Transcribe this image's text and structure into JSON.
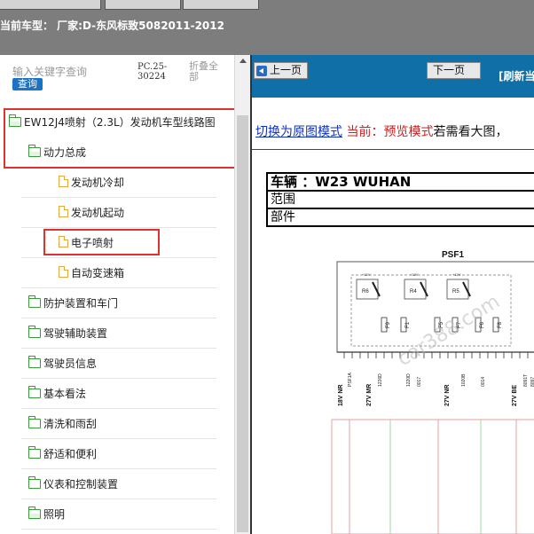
{
  "header": {
    "vehicle_line": "当前车型： 厂家:D-东风标致5082011-2012"
  },
  "sidebar": {
    "search_placeholder": "输入关键字查询",
    "search_button": "查询",
    "pc_code": "PC.25-30224",
    "collapse_all": "折叠全部",
    "tree": [
      {
        "label": "EW12J4喷射（2.3L）发动机车型线路图",
        "icon": "folder-open-icon",
        "level": 0
      },
      {
        "label": "动力总成",
        "icon": "folder-open-icon",
        "level": 1
      },
      {
        "label": "发动机冷却",
        "icon": "file-icon",
        "level": 2
      },
      {
        "label": "发动机起动",
        "icon": "file-icon",
        "level": 2
      },
      {
        "label": "电子喷射",
        "icon": "file-icon",
        "level": 2
      },
      {
        "label": "自动变速箱",
        "icon": "file-icon",
        "level": 2
      },
      {
        "label": "防护装置和车门",
        "icon": "folder-icon",
        "level": 1
      },
      {
        "label": "驾驶辅助装置",
        "icon": "folder-icon",
        "level": 1
      },
      {
        "label": "驾驶员信息",
        "icon": "folder-icon",
        "level": 1
      },
      {
        "label": "基本看法",
        "icon": "folder-icon",
        "level": 1
      },
      {
        "label": "清洗和雨刮",
        "icon": "folder-icon",
        "level": 1
      },
      {
        "label": "舒适和便利",
        "icon": "folder-icon",
        "level": 1
      },
      {
        "label": "仪表和控制装置",
        "icon": "folder-icon",
        "level": 1
      },
      {
        "label": "照明",
        "icon": "folder-open-icon",
        "level": 1
      }
    ]
  },
  "viewer": {
    "prev_page": "上一页",
    "next_page": "下一页",
    "refresh_text": "[刷新当",
    "switch_link": "切换为原图模式",
    "current_mode": "当前：预览模式",
    "hint": "若需看大图，",
    "table": {
      "vehicle": "车辆 ：W23 WUHAN",
      "scope": "范围",
      "part": "部件"
    },
    "diagram": {
      "title": "PSF1",
      "relays": [
        "R6",
        "R4",
        "R5"
      ],
      "relay_volt": "+12V",
      "fuses": [
        "F9",
        "F1",
        "F5",
        "F7",
        "F6",
        "F8"
      ],
      "wires": [
        "18V NR",
        "27V MR",
        "27V NR",
        "27V BE"
      ],
      "wire_codes": [
        "PSF1A",
        "1226D",
        "1220D",
        "0017",
        "1020B",
        "0014",
        "8091T",
        "8097"
      ],
      "watermark": "car388.com"
    }
  },
  "colors": {
    "nav_blue": "#0f6fa6",
    "highlight_red": "#e03030",
    "folder_green": "#3a9a3a",
    "file_orange": "#e6a640",
    "link_blue": "#1133bb"
  }
}
